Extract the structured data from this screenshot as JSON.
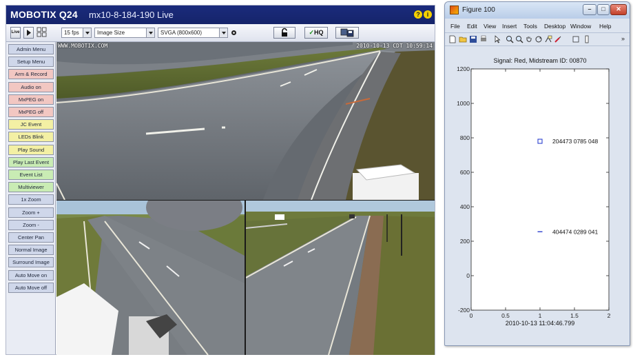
{
  "mobotix": {
    "brand": "MOBOTIX Q24",
    "camera_name": "mx10-8-184-190 Live",
    "toolbar": {
      "live_label": "Live",
      "framerate": "15 fps",
      "image_size": "Image Size",
      "resolution": "SVGA (800x600)",
      "hq_label": "HQ"
    },
    "sidebar_items": [
      {
        "label": "Admin Menu",
        "color": "#cfd7ea"
      },
      {
        "label": "Setup Menu",
        "color": "#cfd7ea"
      },
      {
        "label": "Arm & Record",
        "color": "#f2c7c2"
      },
      {
        "label": "Audio on",
        "color": "#f2c7c2"
      },
      {
        "label": "MxPEG on",
        "color": "#f2c7c2"
      },
      {
        "label": "MxPEG off",
        "color": "#f2c7c2"
      },
      {
        "label": "JC Event",
        "color": "#f3f0a4"
      },
      {
        "label": "LEDs Blink",
        "color": "#f3f0a4"
      },
      {
        "label": "Play Sound",
        "color": "#f3f0a4"
      },
      {
        "label": "Play Last Event",
        "color": "#c9ecb4"
      },
      {
        "label": "Event List",
        "color": "#c9ecb4"
      },
      {
        "label": "Multiviewer",
        "color": "#c9ecb4"
      },
      {
        "label": "1x Zoom",
        "color": "#cfd7ea"
      },
      {
        "label": "Zoom +",
        "color": "#cfd7ea"
      },
      {
        "label": "Zoom -",
        "color": "#cfd7ea"
      },
      {
        "label": "Center Pan",
        "color": "#cfd7ea"
      },
      {
        "label": "Normal Image",
        "color": "#cfd7ea"
      },
      {
        "label": "Surround Image",
        "color": "#cfd7ea"
      },
      {
        "label": "Auto Move on",
        "color": "#cfd7ea"
      },
      {
        "label": "Auto Move off",
        "color": "#cfd7ea"
      }
    ],
    "osd_left": "WWW.MOBOTIX.COM",
    "osd_right": "2010-10-13 CDT 10:59:14"
  },
  "figure": {
    "window_title": "Figure 100",
    "menu": [
      "File",
      "Edit",
      "View",
      "Insert",
      "Tools",
      "Desktop",
      "Window",
      "Help"
    ]
  },
  "chart_data": {
    "type": "scatter",
    "title": "Signal: Red, Midstream ID: 00870",
    "xlabel": "2010-10-13 11:04:46.799",
    "ylabel": "",
    "xlim": [
      0,
      2
    ],
    "ylim": [
      -200,
      1200
    ],
    "xticks": [
      0,
      0.5,
      1,
      1.5,
      2
    ],
    "xtick_labels": [
      "0",
      "0.5",
      "1",
      "1.5",
      "2"
    ],
    "yticks": [
      -200,
      0,
      200,
      400,
      600,
      800,
      1000,
      1200
    ],
    "ytick_labels": [
      "-200",
      "0",
      "200",
      "400",
      "600",
      "800",
      "1000",
      "1200"
    ],
    "points": [
      {
        "x": 1,
        "y": 780,
        "marker": "square",
        "label": "204473 0785 048"
      },
      {
        "x": 1,
        "y": 255,
        "marker": "dash",
        "label": "404474 0289 041"
      }
    ],
    "marker_color": "#2b3fcf"
  }
}
